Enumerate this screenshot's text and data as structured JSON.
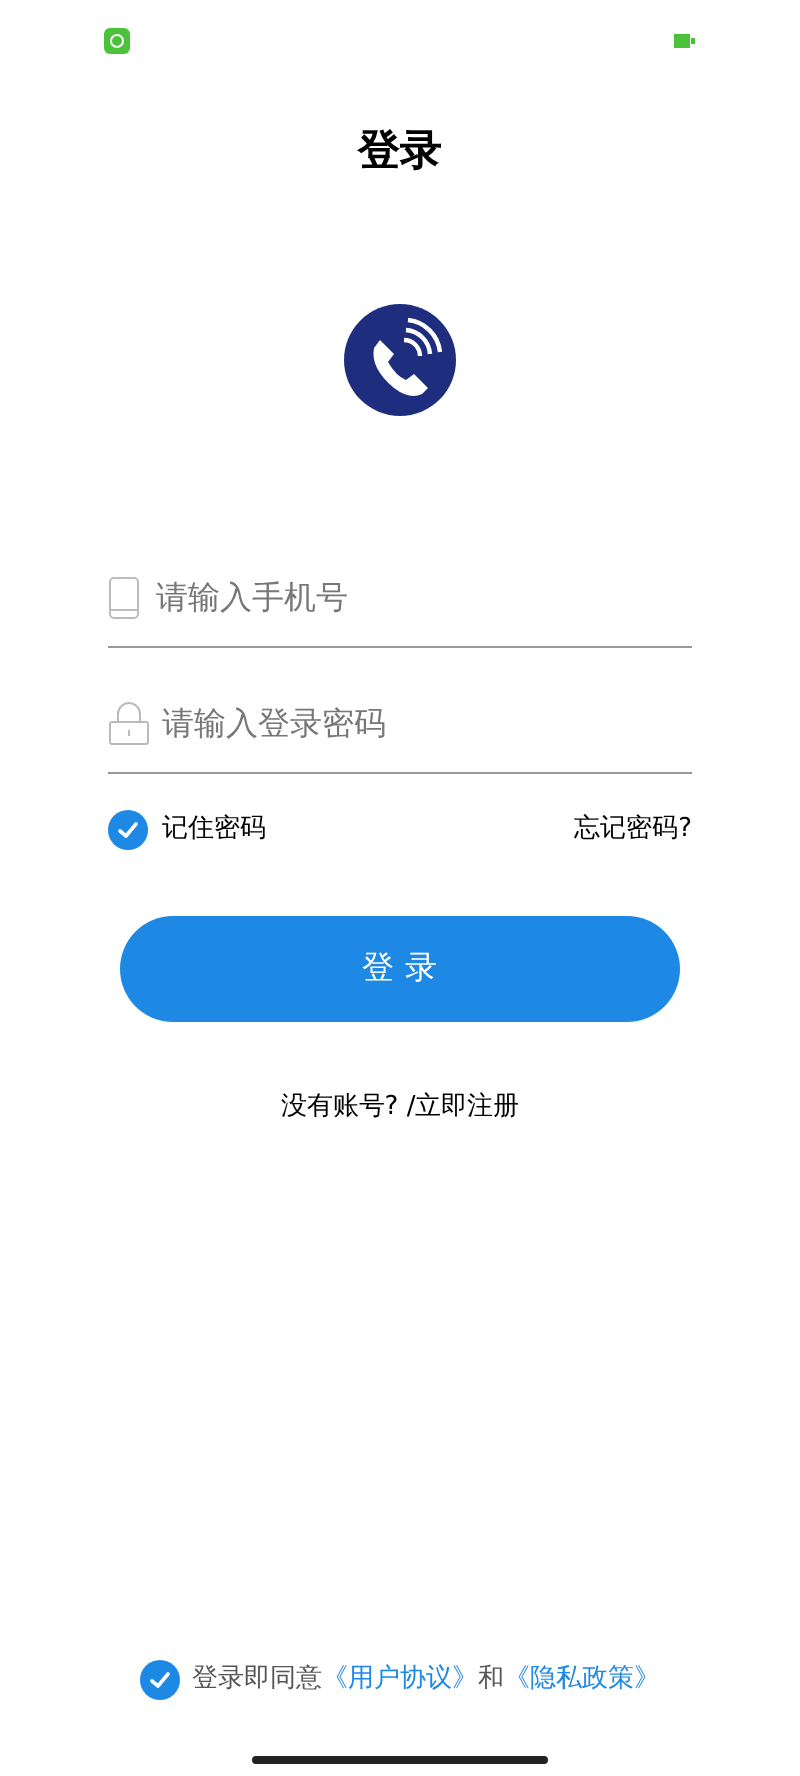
{
  "title": "登录",
  "phone_field": {
    "placeholder": "请输入手机号"
  },
  "password_field": {
    "placeholder": "请输入登录密码"
  },
  "remember": {
    "label": "记住密码",
    "checked": true
  },
  "forgot_link": "忘记密码?",
  "login_button": "登 录",
  "register_link": "没有账号? /立即注册",
  "agreement": {
    "checked": true,
    "text": "登录即同意",
    "link_1": "《用户协议》",
    "joiner": "和",
    "link_2": "《隐私政策》"
  }
}
